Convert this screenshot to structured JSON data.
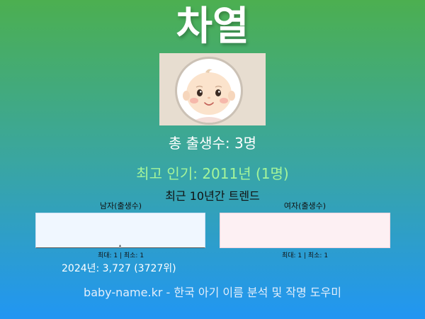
{
  "name": "차열",
  "avatar": {
    "icon": "baby-face-illustration"
  },
  "stats": {
    "total_births": "총 출생수: 3명",
    "top_popularity": "최고 인기: 2011년 (1명)"
  },
  "trend": {
    "heading": "최근 10년간 트렌드",
    "male": {
      "label": "남자(출생수)",
      "minmax": "최대: 1 | 최소: 1"
    },
    "female": {
      "label": "여자(출생수)",
      "minmax": "최대: 1 | 최소: 1"
    }
  },
  "year_stat": "2024년: 3,727 (3727위)",
  "footer": "baby-name.kr - 한국 아기 이름 분석 및 작명 도우미",
  "colors": {
    "gradient_top": "#4caf50",
    "gradient_bottom": "#2196f3",
    "highlight_green": "#a5f59a",
    "male_chart_bg": "#f0f7ff",
    "female_chart_bg": "#fdf0f3"
  }
}
